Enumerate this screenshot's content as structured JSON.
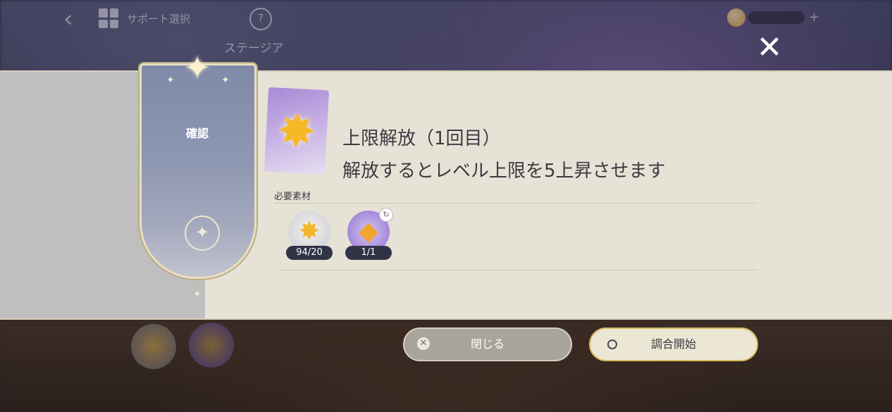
{
  "top_bar": {
    "title": "サポート選択",
    "subtitle": "ステージア",
    "help": "?"
  },
  "close_glyph": "✕",
  "banner": {
    "title": "確認"
  },
  "item": {
    "heading": "上限解放（1回目）",
    "description": "解放するとレベル上限を5上昇させます"
  },
  "materials": {
    "label": "必要素材",
    "items": [
      {
        "icon": "star-material-icon",
        "count": "94/20"
      },
      {
        "icon": "crystal-material-icon",
        "count": "1/1"
      }
    ]
  },
  "buttons": {
    "close_label": "閉じる",
    "start_label": "調合開始"
  },
  "colors": {
    "panel": "#e6e2d6",
    "banner": "#8e97b2",
    "accent_gold": "#d8ba5e",
    "count_badge": "#2f3346"
  }
}
